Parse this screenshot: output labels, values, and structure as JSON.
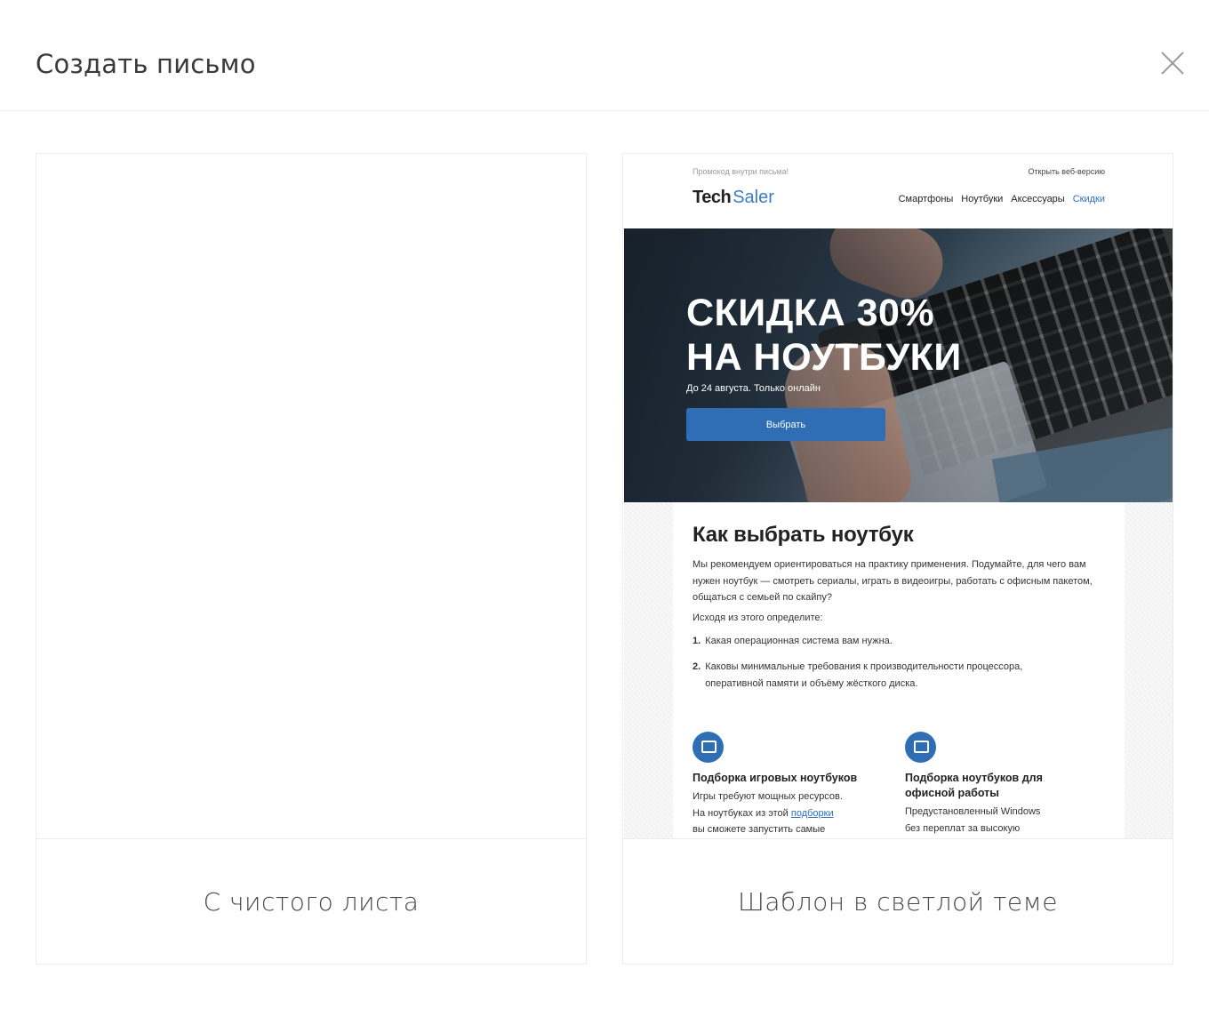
{
  "modal": {
    "title": "Создать письмо",
    "close_icon": "close-icon"
  },
  "cards": [
    {
      "id": "blank",
      "caption": "С чистого листа"
    },
    {
      "id": "template",
      "caption": "Шаблон в светлой теме"
    }
  ],
  "template_preview": {
    "promo": "Промокод внутри письма!",
    "web_version": "Открыть веб-версию",
    "logo_bold": "Tech",
    "logo_light": "Saler",
    "nav": [
      "Смартфоны",
      "Ноутбуки",
      "Аксессуары",
      "Скидки"
    ],
    "hero": {
      "title_line1": "СКИДКА 30%",
      "title_line2": "НА НОУТБУКИ",
      "subtitle": "До 24 августа. Только онлайн",
      "button": "Выбрать"
    },
    "article": {
      "heading": "Как выбрать ноутбук",
      "paragraph": "Мы рекомендуем ориентироваться на практику применения. Подумайте, для чего вам нужен ноутбук — смотреть сериалы, играть в видеоигры, работать с офисным пакетом, общаться с семьей по скайпу?",
      "lead": "Исходя из этого определите:",
      "items": [
        {
          "num": "1.",
          "text": "Какая операционная система вам нужна."
        },
        {
          "num": "2.",
          "text": "Каковы минимальные требования к производительности процессора, оперативной памяти и объёму жёсткого диска."
        }
      ]
    },
    "features": [
      {
        "title": "Подборка игровых ноутбуков",
        "line1": "Игры требуют мощных ресурсов.",
        "line2_before": "На ноутбуках из этой ",
        "link": "подборки",
        "line3": "вы сможете запустить самые"
      },
      {
        "title": "Подборка ноутбуков для офисной работы",
        "line1": "Предустановленный Windows",
        "line2": "без переплат за высокую"
      }
    ]
  },
  "colors": {
    "accent": "#2f6db4",
    "border": "#ececec"
  }
}
